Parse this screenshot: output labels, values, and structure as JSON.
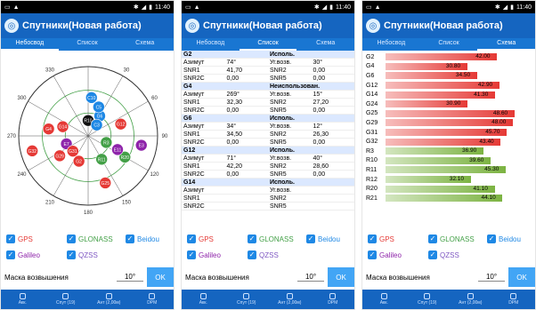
{
  "status": {
    "time": "11:40"
  },
  "app": {
    "title": "Спутники(Новая работа)"
  },
  "tabs": [
    "Небосвод",
    "Список",
    "Схема"
  ],
  "legend": {
    "gps": {
      "label": "GPS",
      "color": "#e53935"
    },
    "glonass": {
      "label": "GLONASS",
      "color": "#43a047"
    },
    "beidou": {
      "label": "Beidou",
      "color": "#1e88e5"
    },
    "galileo": {
      "label": "Galileo",
      "color": "#8e24aa"
    },
    "qzss": {
      "label": "QZSS",
      "color": "#7e57c2"
    }
  },
  "mask": {
    "label": "Маска возвышения",
    "value": "10°",
    "ok": "OK"
  },
  "bottom": [
    "Акк.",
    "Спут (19)",
    "Ант (2,00м)",
    "DPM"
  ],
  "skyplot": {
    "labels": [
      "330",
      "30",
      "300",
      "60",
      "270",
      "90",
      "240",
      "120",
      "210",
      "150",
      "180"
    ],
    "satellites": [
      {
        "id": "R10",
        "color": "#111111"
      },
      {
        "id": "G6",
        "color": "#1e88e5"
      },
      {
        "id": "C3",
        "color": "#1e88e5"
      },
      {
        "id": "G12",
        "color": "#e53935"
      },
      {
        "id": "G4",
        "color": "#e53935"
      },
      {
        "id": "G14",
        "color": "#e53935"
      },
      {
        "id": "C5",
        "color": "#1e88e5"
      },
      {
        "id": "R20",
        "color": "#43a047"
      },
      {
        "id": "E11",
        "color": "#8e24aa"
      },
      {
        "id": "E7",
        "color": "#8e24aa"
      },
      {
        "id": "C10",
        "color": "#1e88e5"
      },
      {
        "id": "G29",
        "color": "#e53935"
      },
      {
        "id": "G31",
        "color": "#e53935"
      },
      {
        "id": "R11",
        "color": "#43a047"
      },
      {
        "id": "G2",
        "color": "#e53935"
      },
      {
        "id": "G25",
        "color": "#e53935"
      },
      {
        "id": "G32",
        "color": "#e53935"
      },
      {
        "id": "R3",
        "color": "#43a047"
      },
      {
        "id": "E3",
        "color": "#8e24aa"
      }
    ]
  },
  "list": [
    {
      "name": "G2",
      "status": "Исполь.",
      "az": "74°",
      "el": "30°",
      "snr1": "41,70",
      "snr2": "0,00",
      "snr2c": "0,00",
      "snr5": "0,00"
    },
    {
      "name": "G4",
      "status": "Неиспользован.",
      "az": "269°",
      "el": "15°",
      "snr1": "32,30",
      "snr2": "27,20",
      "snr2c": "0,00",
      "snr5": "0,00"
    },
    {
      "name": "G6",
      "status": "Исполь.",
      "az": "34°",
      "el": "12°",
      "snr1": "34,50",
      "snr2": "26,30",
      "snr2c": "0,00",
      "snr5": "0,00"
    },
    {
      "name": "G12",
      "status": "Исполь.",
      "az": "71°",
      "el": "40°",
      "snr1": "42,20",
      "snr2": "28,60",
      "snr2c": "0,00",
      "snr5": "0,00"
    },
    {
      "name": "G14",
      "status": "Исполь.",
      "az": "",
      "el": "",
      "snr1": "",
      "snr2": "",
      "snr2c": "",
      "snr5": ""
    }
  ],
  "listLabels": {
    "az": "Азимут",
    "el": "Уг.возв.",
    "snr1": "SNR1",
    "snr2": "SNR2",
    "snr2c": "SNR2C",
    "snr5": "SNR5"
  },
  "chart_data": {
    "type": "bar",
    "categories": [
      "G2",
      "G4",
      "G6",
      "G12",
      "G14",
      "G24",
      "G25",
      "G29",
      "G31",
      "G32",
      "R3",
      "R10",
      "R11",
      "R12",
      "R20",
      "R21"
    ],
    "values": [
      42.0,
      30.8,
      34.5,
      42.9,
      41.3,
      30.9,
      48.6,
      48.0,
      45.7,
      43.4,
      36.9,
      39.6,
      45.3,
      32.1,
      41.1,
      44.1
    ],
    "labels": [
      "42.00",
      "30.80",
      "34.50",
      "42.90",
      "41.30",
      "30.90",
      "48.60",
      "48.00",
      "45.70",
      "43.40",
      "36.90",
      "39.60",
      "45.30",
      "32.10",
      "41.10",
      "44.10"
    ],
    "gps_color": "#e53935",
    "glonass_color": "#7cb342",
    "xlim": [
      0,
      55
    ]
  }
}
